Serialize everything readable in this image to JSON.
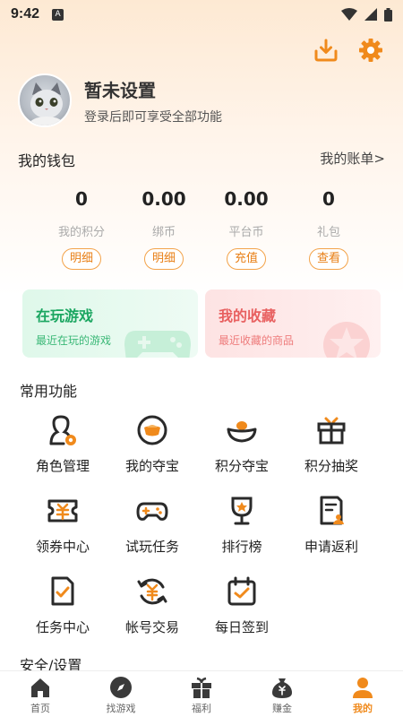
{
  "status_bar": {
    "time": "9:42",
    "badge": "A"
  },
  "profile": {
    "name": "暂未设置",
    "subtitle": "登录后即可享受全部功能"
  },
  "wallet": {
    "title": "我的钱包",
    "bill_link": "我的账单>",
    "items": [
      {
        "value": "0",
        "label": "我的积分",
        "button": "明细"
      },
      {
        "value": "0.00",
        "label": "绑币",
        "button": "明细"
      },
      {
        "value": "0.00",
        "label": "平台币",
        "button": "充值"
      },
      {
        "value": "0",
        "label": "礼包",
        "button": "查看"
      }
    ]
  },
  "cards": {
    "playing": {
      "title": "在玩游戏",
      "subtitle": "最近在玩的游戏"
    },
    "favorites": {
      "title": "我的收藏",
      "subtitle": "最近收藏的商品"
    }
  },
  "functions": {
    "title": "常用功能",
    "items": [
      {
        "label": "角色管理",
        "icon": "role-manage-icon"
      },
      {
        "label": "我的夺宝",
        "icon": "treasure-icon"
      },
      {
        "label": "积分夺宝",
        "icon": "ingot-icon"
      },
      {
        "label": "积分抽奖",
        "icon": "gift-box-icon"
      },
      {
        "label": "领券中心",
        "icon": "coupon-icon"
      },
      {
        "label": "试玩任务",
        "icon": "gamepad-icon"
      },
      {
        "label": "排行榜",
        "icon": "trophy-icon"
      },
      {
        "label": "申请返利",
        "icon": "rebate-doc-icon"
      },
      {
        "label": "任务中心",
        "icon": "task-doc-icon"
      },
      {
        "label": "帐号交易",
        "icon": "account-trade-icon"
      },
      {
        "label": "每日签到",
        "icon": "calendar-check-icon"
      }
    ]
  },
  "security": {
    "title": "安全/设置"
  },
  "tabbar": {
    "items": [
      {
        "label": "首页",
        "icon": "home-icon"
      },
      {
        "label": "找游戏",
        "icon": "compass-icon"
      },
      {
        "label": "福利",
        "icon": "gift-icon"
      },
      {
        "label": "赚金",
        "icon": "money-bag-icon"
      },
      {
        "label": "我的",
        "icon": "user-icon"
      }
    ],
    "active_index": 4
  },
  "colors": {
    "accent": "#f08a1c",
    "dark_icon": "#2a2a2a",
    "green": "#1ba661",
    "red": "#e86060"
  }
}
